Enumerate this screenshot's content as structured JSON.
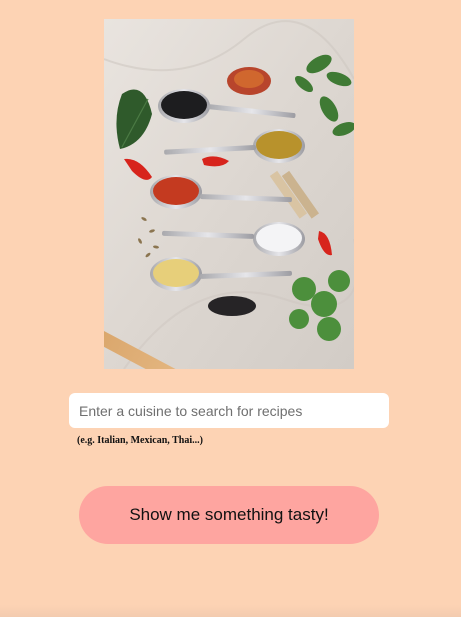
{
  "hero_image": {
    "subject": "spices-in-spoons-photo"
  },
  "search": {
    "placeholder": "Enter a cuisine to search for recipes",
    "value": "",
    "hint": "(e.g. Italian, Mexican, Thai...)"
  },
  "actions": {
    "submit_label": "Show me something tasty!"
  },
  "colors": {
    "page_background": "#fdd3b4",
    "button_background": "#fea5a0",
    "input_background": "#ffffff"
  }
}
